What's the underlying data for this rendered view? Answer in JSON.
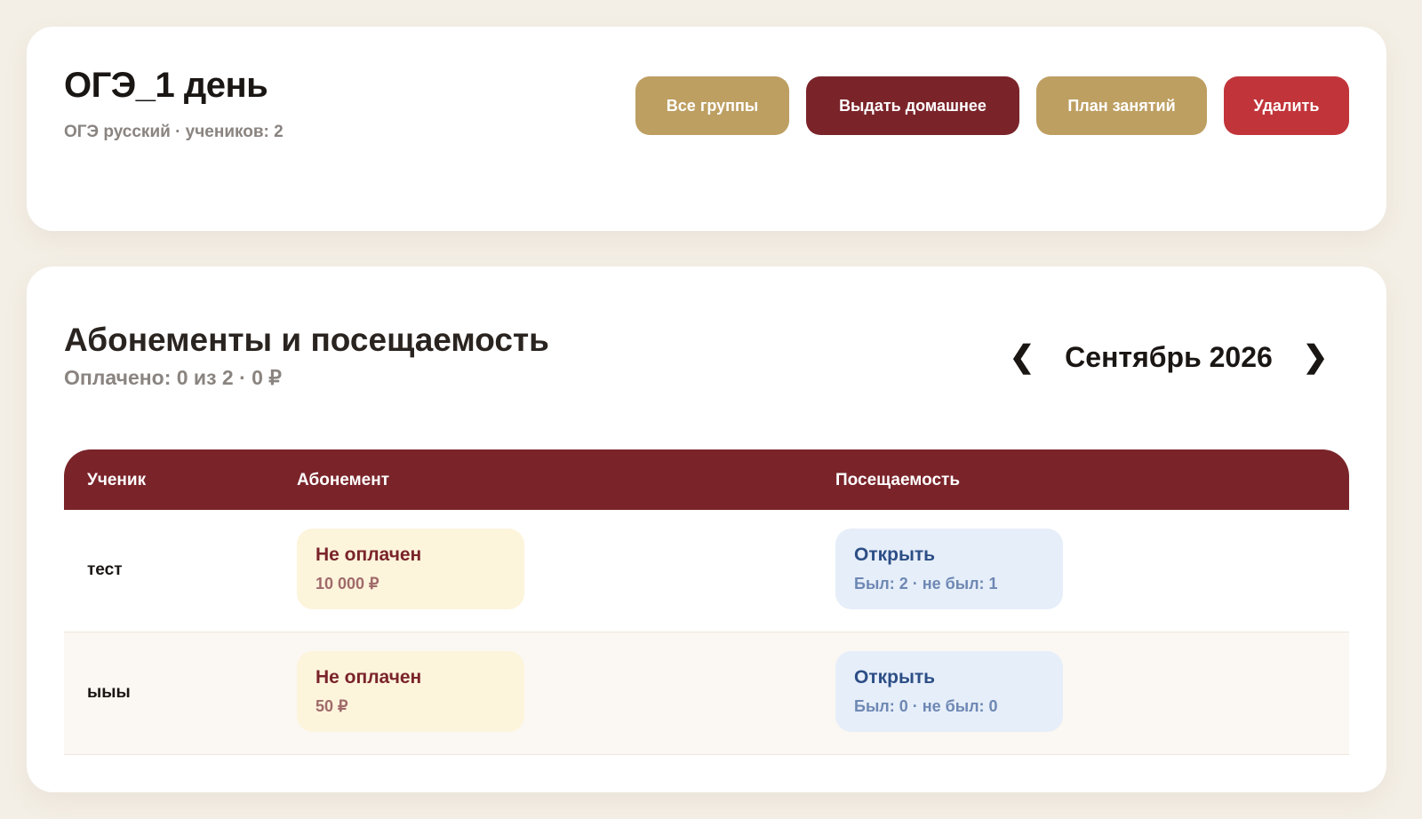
{
  "group": {
    "title": "ОГЭ_1 день",
    "meta": "ОГЭ русский · учеников: 2",
    "buttons": {
      "all_groups": "Все группы",
      "assign_homework": "Выдать домашнее",
      "lesson_plan": "План занятий",
      "delete": "Удалить"
    }
  },
  "subscriptions": {
    "title": "Абонементы и посещаемость",
    "summary": "Оплачено: 0 из 2 · 0 ₽",
    "month_nav": {
      "prev_glyph": "❮",
      "month": "Сентябрь 2026",
      "next_glyph": "❯"
    },
    "table": {
      "headers": {
        "student": "Ученик",
        "subscription": "Абонемент",
        "attendance": "Посещаемость"
      },
      "rows": [
        {
          "student": "тест",
          "subscription_status": "Не оплачен",
          "subscription_amount": "10 000 ₽",
          "attendance_action": "Открыть",
          "attendance_counts": "Был: 2 · не был: 1"
        },
        {
          "student": "ыыы",
          "subscription_status": "Не оплачен",
          "subscription_amount": "50 ₽",
          "attendance_action": "Открыть",
          "attendance_counts": "Был: 0 · не был: 0"
        }
      ]
    }
  },
  "colors": {
    "page_background": "#f4efe6",
    "gold_button": "#bd9f62",
    "maroon": "#7a242a",
    "delete_red": "#c1353a",
    "unpaid_pill": "#fdf4dc",
    "attendance_pill": "#e6eef9"
  },
  "icons": {
    "prev_month": "chevron-left-icon",
    "next_month": "chevron-right-icon"
  }
}
